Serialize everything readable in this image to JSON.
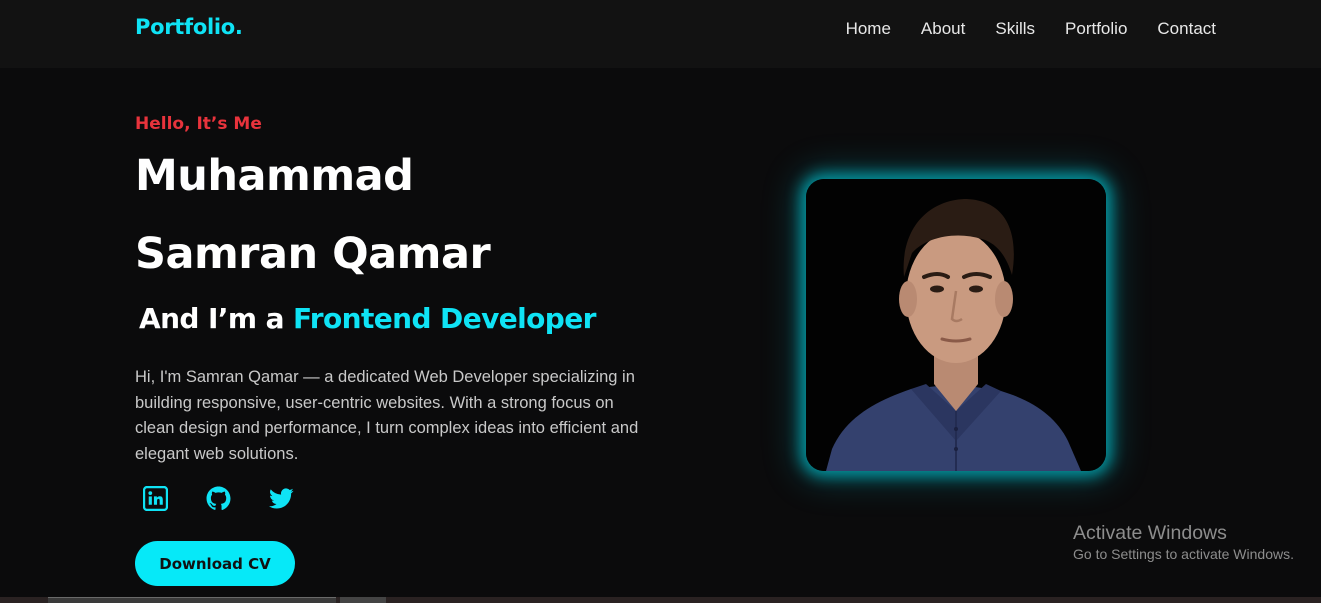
{
  "header": {
    "logo": "Portfolio.",
    "nav": [
      "Home",
      "About",
      "Skills",
      "Portfolio",
      "Contact"
    ]
  },
  "hero": {
    "greeting": "Hello, It’s Me",
    "name_line_1": "Muhammad",
    "name_line_2": "Samran Qamar",
    "role_prefix": "And I’m a ",
    "role_accent": "Frontend Developer",
    "bio": "Hi, I'm Samran Qamar — a dedicated Web Developer specializing in building responsive, user-centric websites. With a strong focus on clean design and performance, I turn complex ideas into efficient and elegant web solutions.",
    "socials": [
      "linkedin-icon",
      "github-icon",
      "twitter-icon"
    ],
    "download_label": "Download CV"
  },
  "watermark": {
    "title": "Activate Windows",
    "subtitle": "Go to Settings to activate Windows."
  },
  "colors": {
    "accent": "#0fe3f5",
    "greeting": "#e8333c",
    "background": "#0b0b0c",
    "header": "#121212"
  }
}
